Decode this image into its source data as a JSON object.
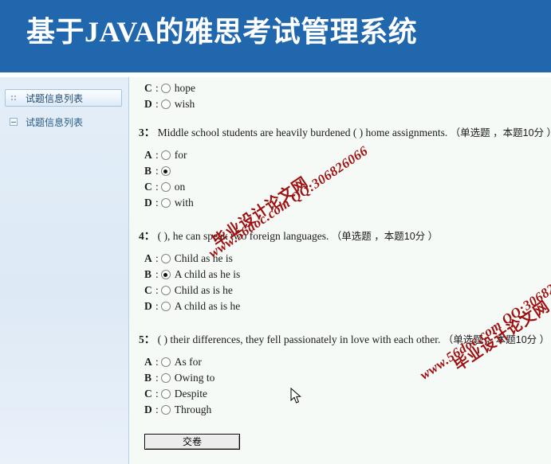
{
  "banner": {
    "title": "基于JAVA的雅思考试管理系统",
    "bg_color": "#2167ad",
    "text_color": "#ffffff"
  },
  "sidebar": {
    "bg_color": "#dde9f5",
    "panel_header": {
      "label": "试题信息列表",
      "icon": "grip-dots-icon"
    },
    "tree_items": [
      {
        "label": "试题信息列表",
        "icon": "tree-collapse-icon"
      }
    ]
  },
  "content": {
    "bg_color": "#f6faf7",
    "questions": [
      {
        "id": "q2-tail",
        "partial": true,
        "stem": "",
        "meta": "",
        "options": [
          {
            "letter": "C",
            "text": "hope",
            "checked": false
          },
          {
            "letter": "D",
            "text": "wish",
            "checked": false
          }
        ]
      },
      {
        "id": "q3",
        "partial": false,
        "number": "3：",
        "stem": "Middle school students are heavily burdened ( ) home assignments.",
        "meta": "（单选题 ，本题10分 ）",
        "options": [
          {
            "letter": "A",
            "text": "for",
            "checked": false
          },
          {
            "letter": "B",
            "text": "",
            "checked": true
          },
          {
            "letter": "C",
            "text": "on",
            "checked": false
          },
          {
            "letter": "D",
            "text": "with",
            "checked": false
          }
        ]
      },
      {
        "id": "q4",
        "partial": false,
        "number": "4：",
        "stem": "( ), he can speak two foreign languages.",
        "meta": "（单选题 ，本题10分 ）",
        "options": [
          {
            "letter": "A",
            "text": "Child as he is",
            "checked": false
          },
          {
            "letter": "B",
            "text": "A child as he is",
            "checked": true
          },
          {
            "letter": "C",
            "text": "Child as is he",
            "checked": false
          },
          {
            "letter": "D",
            "text": "A child as is he",
            "checked": false
          }
        ]
      },
      {
        "id": "q5",
        "partial": false,
        "number": "5：",
        "stem": "( ) their differences, they fell passionately in love with each other.",
        "meta": "（单选题 ，本题10分 ）",
        "options": [
          {
            "letter": "A",
            "text": "As for",
            "checked": false
          },
          {
            "letter": "B",
            "text": "Owing to",
            "checked": false
          },
          {
            "letter": "C",
            "text": "Despite",
            "checked": false
          },
          {
            "letter": "D",
            "text": "Through",
            "checked": false
          }
        ]
      }
    ],
    "submit_label": "交卷"
  },
  "watermark": {
    "url_text": "www.56doc.com  QQ:306826066",
    "site_text": "毕业设计论文网",
    "color": "#9e1111"
  }
}
